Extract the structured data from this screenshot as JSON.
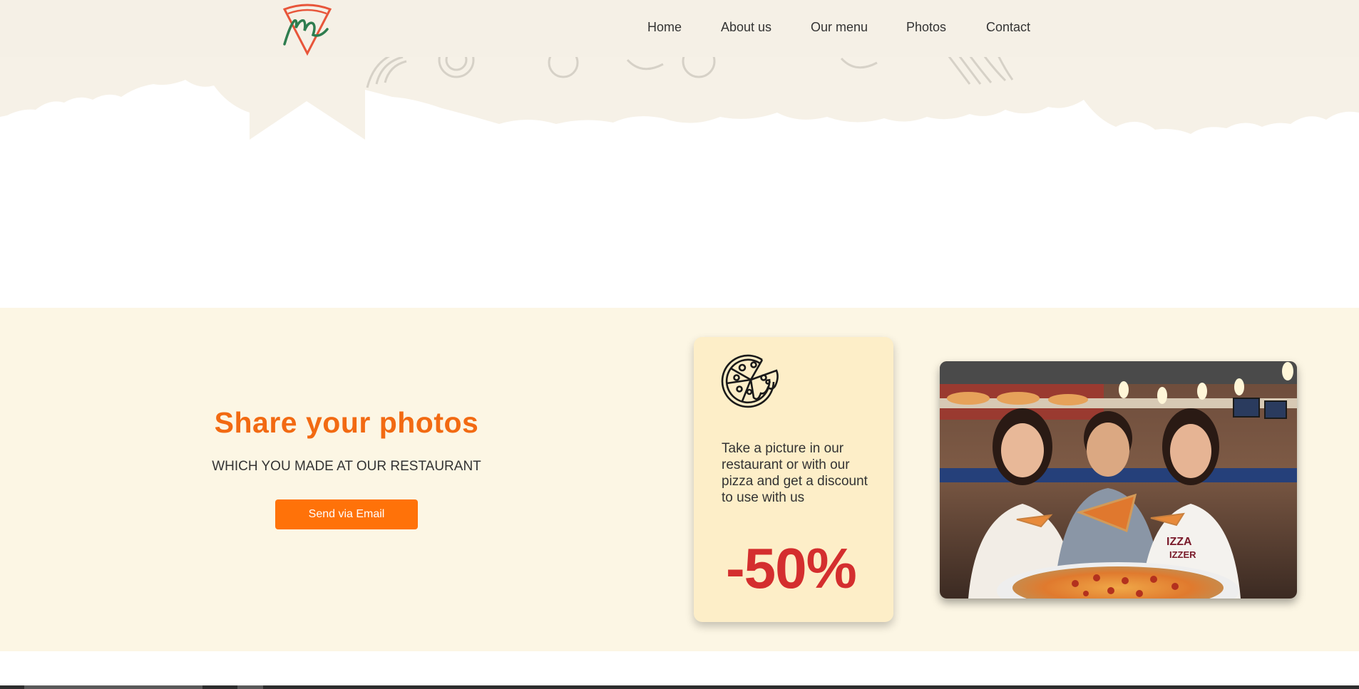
{
  "header": {
    "logo_icon": "pizza-slice-m-logo",
    "nav": [
      {
        "label": "Home"
      },
      {
        "label": "About us"
      },
      {
        "label": "Our menu"
      },
      {
        "label": "Photos"
      },
      {
        "label": "Contact"
      }
    ]
  },
  "share_section": {
    "title": "Share your photos",
    "subtitle": "WHICH YOU MADE AT OUR RESTAURANT",
    "button_label": "Send via Email"
  },
  "promo_card": {
    "icon": "pizza-icon",
    "text": "Take a picture in our restaurant or with our pizza and get a discount to use with us",
    "discount": "-50%"
  },
  "photo": {
    "icon": "friends-eating-pizza-photo"
  },
  "colors": {
    "accent_orange": "#f26a12",
    "button_orange": "#ff7209",
    "discount_red": "#d42e2e",
    "section_bg": "#fcf6e4",
    "card_bg": "#fdeec8",
    "header_bg": "#f5f0e6",
    "logo_green": "#2e7d4f",
    "logo_red": "#e8553a"
  }
}
